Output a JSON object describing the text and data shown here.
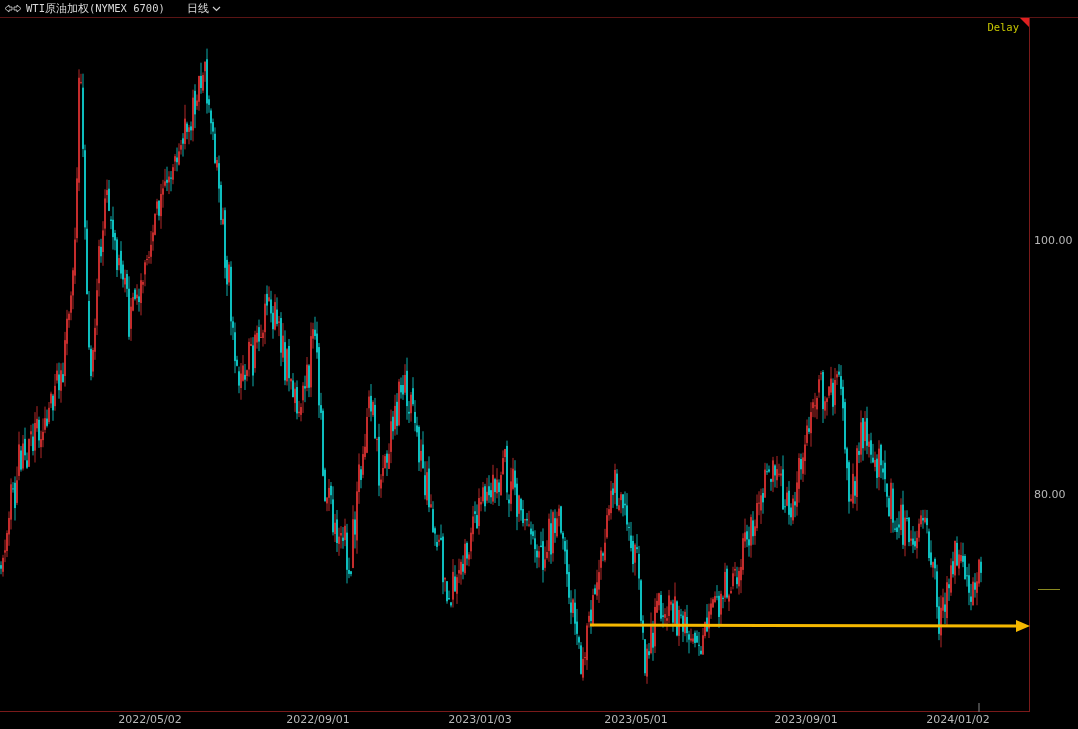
{
  "header": {
    "title": "WTI原油加权(NYMEX 6700)",
    "period": "日线"
  },
  "chart": {
    "status": "Delay",
    "y_axis_labels": [
      "100.00",
      "80.00"
    ],
    "x_axis_labels": [
      "2022/05/02",
      "2022/09/01",
      "2023/01/03",
      "2023/05/01",
      "2023/09/01",
      "2024/01/02"
    ]
  }
}
